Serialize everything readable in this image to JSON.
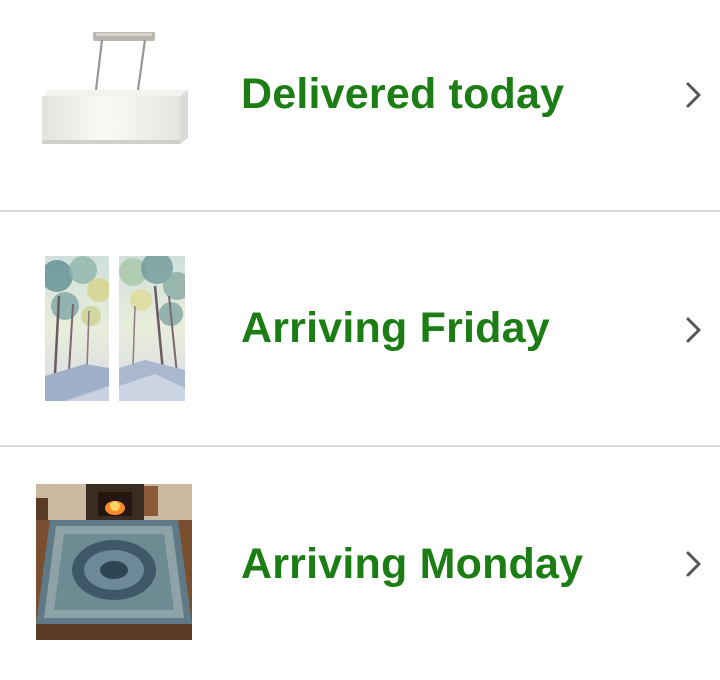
{
  "orders": [
    {
      "status": "Delivered today",
      "thumbnail": "pendant-light-fixture",
      "chevron": "chevron-right-icon"
    },
    {
      "status": "Arriving Friday",
      "thumbnail": "tree-lined-path-canvas-art",
      "chevron": "chevron-right-icon"
    },
    {
      "status": "Arriving Monday",
      "thumbnail": "area-rug-living-room",
      "chevron": "chevron-right-icon"
    }
  ],
  "colors": {
    "status_text": "#1b7d13",
    "divider": "#d5d9d9",
    "chevron": "#555555",
    "background": "#ffffff"
  }
}
